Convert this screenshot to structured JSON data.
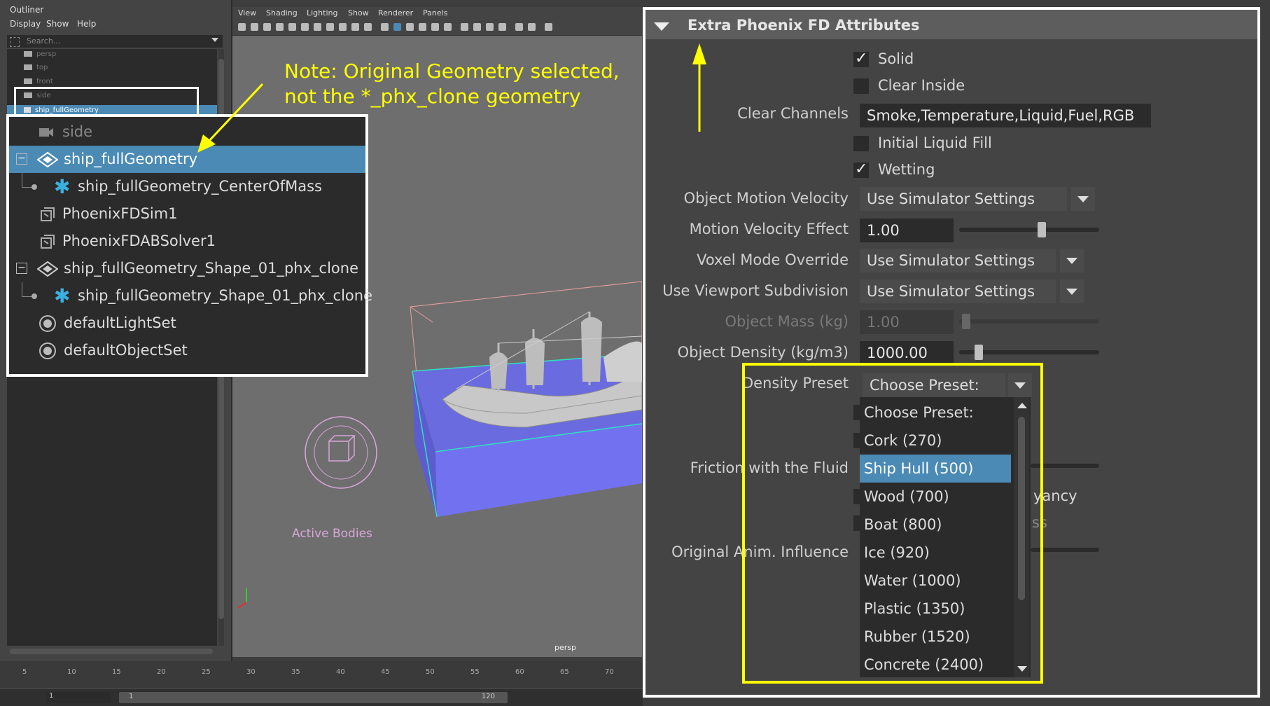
{
  "outliner": {
    "title": "Outliner",
    "menus": [
      "Display",
      "Show",
      "Help"
    ],
    "search_placeholder": "Search...",
    "mini_items": [
      "persp",
      "top",
      "front",
      "side",
      "ship_fullGeometry"
    ]
  },
  "zoom_list": {
    "items": [
      {
        "label": "side",
        "icon": "camera-icon"
      },
      {
        "label": "ship_fullGeometry",
        "icon": "transform-icon"
      },
      {
        "label": "ship_fullGeometry_CenterOfMass",
        "icon": "locator-icon"
      },
      {
        "label": "PhoenixFDSim1",
        "icon": "phoenix-sim-icon"
      },
      {
        "label": "PhoenixFDABSolver1",
        "icon": "phoenix-solver-icon"
      },
      {
        "label": "ship_fullGeometry_Shape_01_phx_clone",
        "icon": "transform-icon"
      },
      {
        "label": "ship_fullGeometry_Shape_01_phx_clone",
        "icon": "locator-icon"
      },
      {
        "label": "defaultLightSet",
        "icon": "set-icon"
      },
      {
        "label": "defaultObjectSet",
        "icon": "set-icon"
      }
    ]
  },
  "viewport": {
    "menus": [
      "View",
      "Shading",
      "Lighting",
      "Show",
      "Renderer",
      "Panels"
    ],
    "camera_label": "persp",
    "active_bodies_label": "Active Bodies"
  },
  "note": {
    "line1": "Note: Original Geometry selected,",
    "line2": "not the *_phx_clone geometry"
  },
  "attr": {
    "header": "Extra Phoenix FD Attributes",
    "solid_label": "Solid",
    "solid_checked": true,
    "clear_inside_label": "Clear Inside",
    "clear_inside_checked": false,
    "clear_channels_label": "Clear Channels",
    "clear_channels_value": "Smoke,Temperature,Liquid,Fuel,RGB",
    "initial_liquid_fill_label": "Initial Liquid Fill",
    "initial_liquid_fill_checked": false,
    "wetting_label": "Wetting",
    "wetting_checked": true,
    "object_motion_velocity_label": "Object Motion Velocity",
    "object_motion_velocity_value": "Use Simulator Settings",
    "motion_velocity_effect_label": "Motion Velocity Effect",
    "motion_velocity_effect_value": "1.00",
    "voxel_mode_override_label": "Voxel Mode Override",
    "voxel_mode_override_value": "Use Simulator Settings",
    "use_viewport_subdivision_label": "Use Viewport Subdivision",
    "use_viewport_subdivision_value": "Use Simulator Settings",
    "object_mass_label": "Object Mass (kg)",
    "object_mass_value": "1.00",
    "object_density_label": "Object Density (kg/m3)",
    "object_density_value": "1000.00",
    "density_preset_label": "Density Preset",
    "density_preset_value": "Choose Preset:",
    "friction_label": "Friction with the Fluid",
    "original_anim_label": "Original Anim. Influence",
    "partial_text_1": "yancy",
    "partial_text_2": "ss"
  },
  "preset_options": [
    "Choose Preset:",
    "Cork (270)",
    "Ship Hull (500)",
    "Wood (700)",
    "Boat (800)",
    "Ice (920)",
    "Water (1000)",
    "Plastic (1350)",
    "Rubber (1520)",
    "Concrete (2400)"
  ],
  "preset_selected_index": 2,
  "timeline": {
    "ticks": [
      "5",
      "10",
      "15",
      "20",
      "25",
      "30",
      "35",
      "40",
      "45",
      "50",
      "55",
      "60",
      "65",
      "70"
    ],
    "start_frame": "1",
    "range_start": "1",
    "range_end": "120"
  },
  "colors": {
    "highlight": "#4a8ab5",
    "annotation_yellow": "#ffff00",
    "annotation_white": "#ffffff",
    "liquid_blue": "#6b6be0"
  }
}
